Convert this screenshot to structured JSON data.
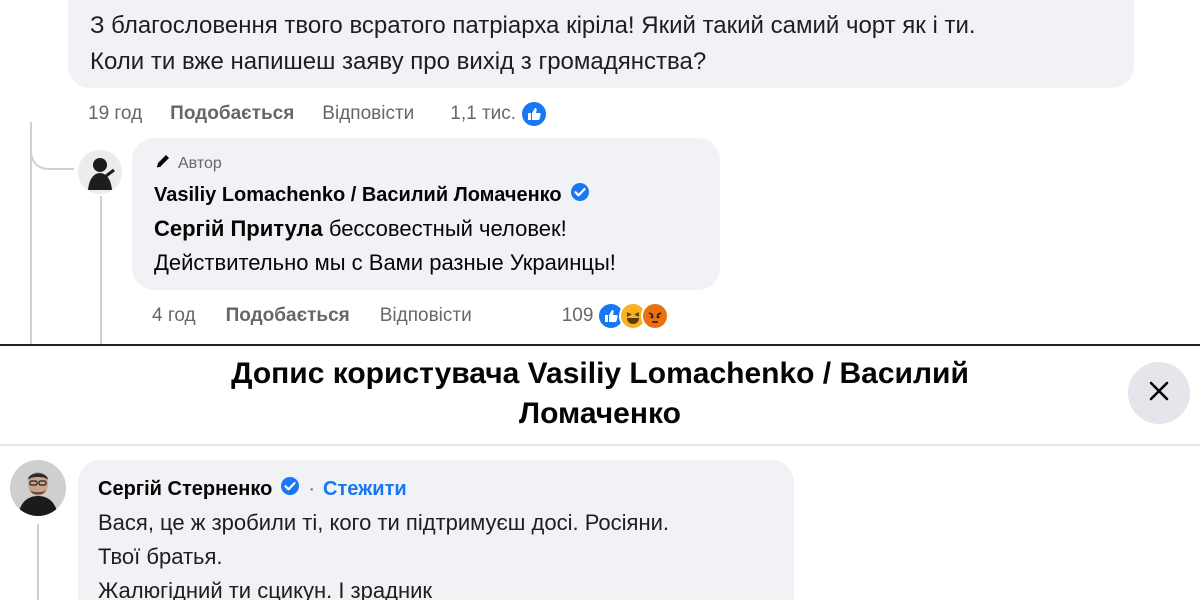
{
  "top_comment": {
    "line1": "З благословення твого всратого патріарха кіріла! Який такий самий чорт як і ти.",
    "line2": "Коли ти вже напишеш заяву про вихід з громадянства?",
    "time": "19 год",
    "like_label": "Подобається",
    "reply_label": "Відповісти",
    "reaction_count": "1,1 тис."
  },
  "reply": {
    "author_badge": "Автор",
    "author_name": "Vasiliy Lomachenko / Василий Ломаченко",
    "mention": "Сергій Притула",
    "text1_rest": " бессовестный человек!",
    "text2": "Действительно мы с Вами разные Украинцы!",
    "time": "4 год",
    "like_label": "Подобається",
    "reply_label": "Відповісти",
    "reaction_count": "109"
  },
  "dialog": {
    "title_line1": "Допис користувача Vasiliy Lomachenko / Василий",
    "title_line2": "Ломаченко"
  },
  "bottom_comment": {
    "author_name": "Сергій Стерненко",
    "separator": "·",
    "follow_label": "Стежити",
    "line1": "Вася, це ж зробили ті, кого ти підтримуєш досі. Росіяни.",
    "line2": "Твої братья.",
    "line3": "Жалюгідний ти сцикун. І зрадник"
  },
  "colors": {
    "bubble": "#f0f2f5",
    "link_blue": "#1877f2",
    "secondary_text": "#65676b"
  }
}
